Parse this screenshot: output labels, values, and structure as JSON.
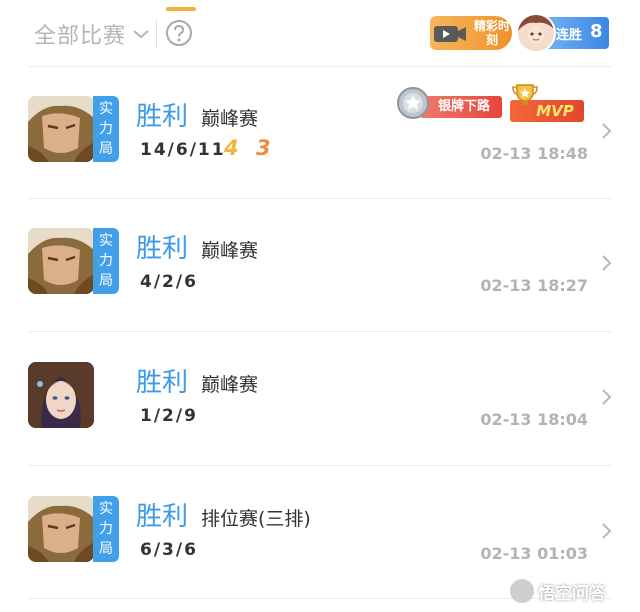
{
  "header": {
    "filter_label": "全部比赛",
    "highlights_label": "精彩时刻",
    "streak_label": "连胜",
    "streak_count": "8"
  },
  "matches": [
    {
      "mode_tag": [
        "实",
        "力",
        "局"
      ],
      "result": "胜利",
      "type": "巅峰赛",
      "kda": "14/6/11",
      "multikill_a": "4",
      "multikill_b": "3",
      "time": "02-13 18:48",
      "rank_badge": "银牌下路",
      "mvp_badge": "MVP"
    },
    {
      "mode_tag": [
        "实",
        "力",
        "局"
      ],
      "result": "胜利",
      "type": "巅峰赛",
      "kda": "4/2/6",
      "time": "02-13 18:27"
    },
    {
      "result": "胜利",
      "type": "巅峰赛",
      "kda": "1/2/9",
      "time": "02-13 18:04"
    },
    {
      "mode_tag": [
        "实",
        "力",
        "局"
      ],
      "result": "胜利",
      "type": "排位赛(三排)",
      "kda": "6/3/6",
      "time": "02-13 01:03"
    }
  ],
  "watermark": "悟空问答",
  "colors": {
    "accent_blue": "#3b9be8",
    "tag_blue": "#42a0ea",
    "timestamp_gray": "#b3b3b3",
    "tab_indicator": "#f0b43c",
    "multikill_gold": "#f5b43a",
    "multikill_orange": "#f08a3c"
  },
  "icons": [
    "chevron-down-icon",
    "help-icon",
    "video-icon",
    "chevron-right-icon",
    "silver-medal-icon",
    "trophy-icon"
  ]
}
